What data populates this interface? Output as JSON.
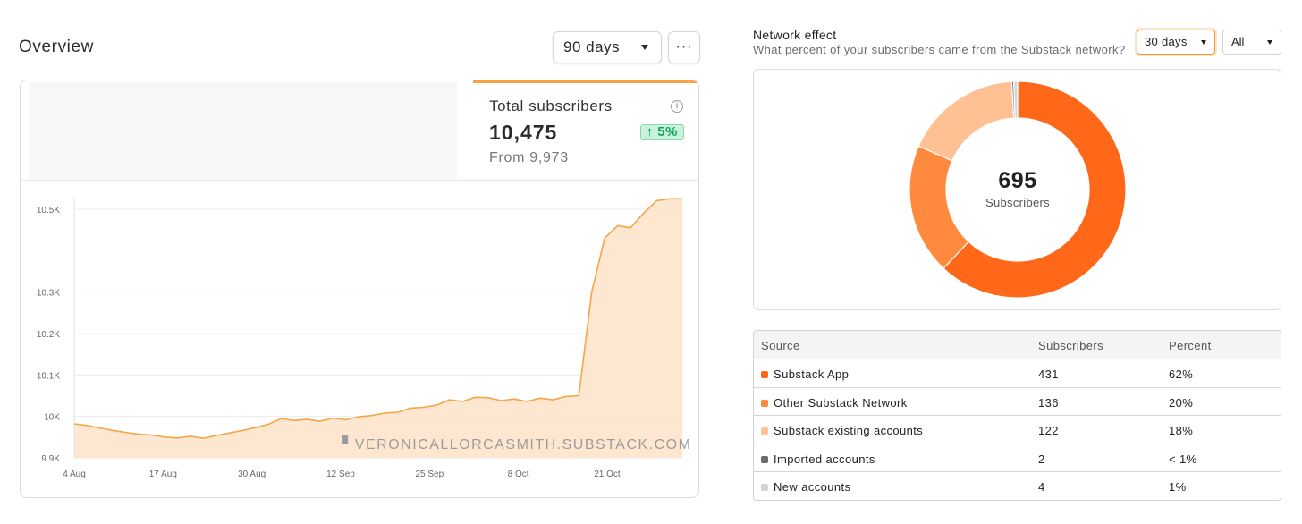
{
  "overview": {
    "title": "Overview",
    "range_selected": "90 days",
    "more_label": "···",
    "stat": {
      "label": "Total subscribers",
      "value": "10,475",
      "change": "↑ 5%",
      "from": "From 9,973"
    }
  },
  "chart_data": [
    {
      "type": "area",
      "title": "",
      "xlabel": "",
      "ylabel": "",
      "x_ticks": [
        "4 Aug",
        "17 Aug",
        "30 Aug",
        "12 Sep",
        "25 Sep",
        "8 Oct",
        "21 Oct"
      ],
      "y_ticks": [
        "10.5K",
        "10.3K",
        "10.2K",
        "10.1K",
        "10K",
        "9.9K"
      ],
      "ylim": [
        9900,
        10530
      ],
      "grid": true,
      "color": "#f5a547",
      "fill": "#fde3c8",
      "x": [
        "4 Aug",
        "6 Aug",
        "8 Aug",
        "10 Aug",
        "12 Aug",
        "14 Aug",
        "16 Aug",
        "18 Aug",
        "20 Aug",
        "22 Aug",
        "24 Aug",
        "26 Aug",
        "28 Aug",
        "30 Aug",
        "1 Sep",
        "3 Sep",
        "5 Sep",
        "7 Sep",
        "9 Sep",
        "11 Sep",
        "13 Sep",
        "15 Sep",
        "17 Sep",
        "19 Sep",
        "21 Sep",
        "23 Sep",
        "25 Sep",
        "27 Sep",
        "29 Sep",
        "1 Oct",
        "3 Oct",
        "5 Oct",
        "7 Oct",
        "9 Oct",
        "11 Oct",
        "13 Oct",
        "15 Oct",
        "17 Oct",
        "19 Oct",
        "21 Oct",
        "22 Oct",
        "23 Oct",
        "24 Oct",
        "25 Oct",
        "27 Oct",
        "29 Oct",
        "31 Oct",
        "1 Nov"
      ],
      "values": [
        9982,
        9978,
        9972,
        9966,
        9961,
        9957,
        9955,
        9950,
        9948,
        9952,
        9947,
        9954,
        9960,
        9966,
        9973,
        9981,
        9995,
        9990,
        9993,
        9988,
        9996,
        9992,
        9999,
        10002,
        10008,
        10010,
        10020,
        10022,
        10027,
        10040,
        10036,
        10046,
        10045,
        10038,
        10042,
        10036,
        10044,
        10040,
        10048,
        10050,
        10300,
        10430,
        10460,
        10455,
        10490,
        10520,
        10525,
        10525
      ]
    },
    {
      "type": "pie",
      "title": "Network effect",
      "total": "695",
      "total_label": "Subscribers",
      "categories": [
        "Substack App",
        "Other Substack Network",
        "Substack existing accounts",
        "Imported accounts",
        "New accounts"
      ],
      "values": [
        431,
        136,
        122,
        2,
        4
      ],
      "colors": [
        "#ff6719",
        "#ff8a3d",
        "#ffc193",
        "#6b6b6b",
        "#d5d5d5"
      ]
    }
  ],
  "watermark": "▘VERONICALLORCASMITH.SUBSTACK.COM",
  "network": {
    "title": "Network effect",
    "subtitle": "What percent of your subscribers came from the Substack network?",
    "range_selected": "30 days",
    "filter_selected": "All",
    "table": {
      "headers": [
        "Source",
        "Subscribers",
        "Percent"
      ],
      "rows": [
        {
          "source": "Substack App",
          "subscribers": "431",
          "percent": "62%",
          "color": "#ff6719"
        },
        {
          "source": "Other Substack Network",
          "subscribers": "136",
          "percent": "20%",
          "color": "#ff8a3d"
        },
        {
          "source": "Substack existing accounts",
          "subscribers": "122",
          "percent": "18%",
          "color": "#ffc193"
        },
        {
          "source": "Imported accounts",
          "subscribers": "2",
          "percent": "< 1%",
          "color": "#6b6b6b"
        },
        {
          "source": "New accounts",
          "subscribers": "4",
          "percent": "1%",
          "color": "#d5d5d5"
        }
      ]
    }
  }
}
